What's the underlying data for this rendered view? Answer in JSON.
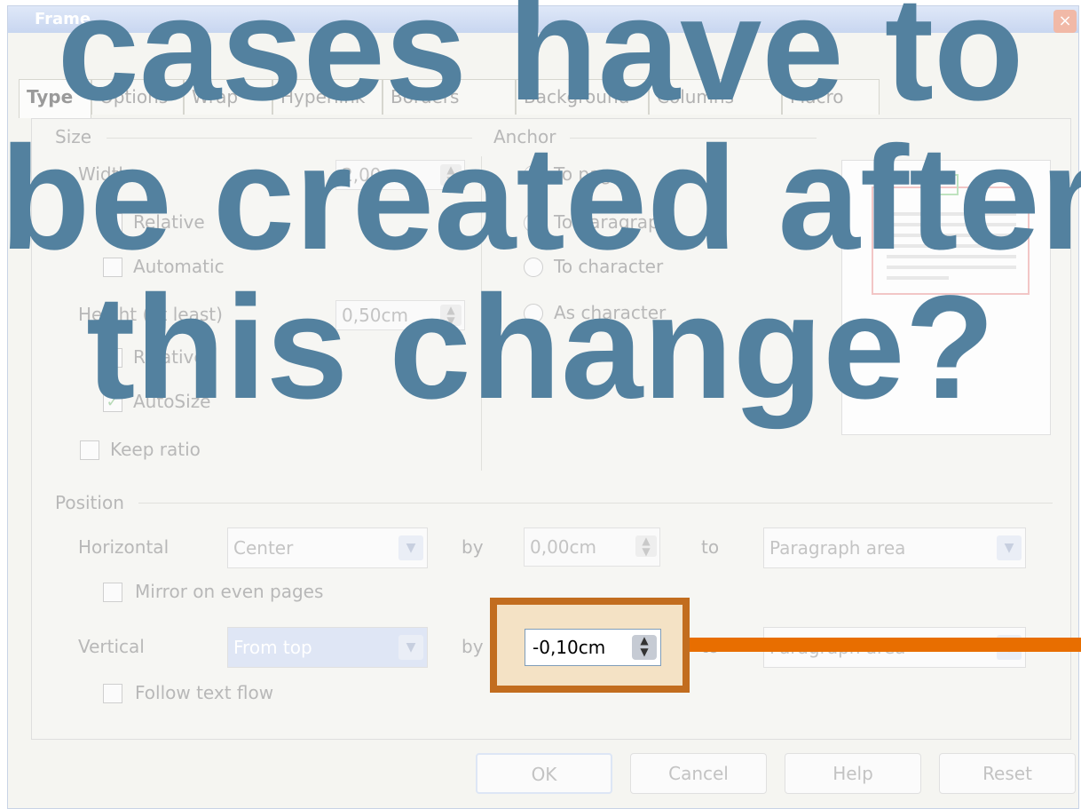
{
  "dialog": {
    "title": "Frame",
    "close_glyph": "×",
    "tabs": [
      "Type",
      "Options",
      "Wrap",
      "Hyperlink",
      "Borders",
      "Background",
      "Columns",
      "Macro"
    ],
    "size": {
      "group_label": "Size",
      "width_label": "Width",
      "width_value": "2,00cm",
      "relative_label": "Relative",
      "automatic_label": "Automatic",
      "height_label": "Height (at least)",
      "height_value": "0,50cm",
      "relative2_label": "Relative",
      "autosize_label": "AutoSize",
      "keep_ratio_label": "Keep ratio"
    },
    "anchor": {
      "group_label": "Anchor",
      "to_page": "To page",
      "to_paragraph": "To paragraph",
      "to_character": "To character",
      "as_character": "As character"
    },
    "position": {
      "group_label": "Position",
      "horizontal_label": "Horizontal",
      "horizontal_value": "Center",
      "by_label": "by",
      "horizontal_by_value": "0,00cm",
      "to_label": "to",
      "horizontal_to_value": "Paragraph area",
      "mirror_label": "Mirror on even pages",
      "vertical_label": "Vertical",
      "vertical_value": "From top",
      "vertical_by_label": "by",
      "vertical_to_label": "to",
      "vertical_to_value": "Paragraph area",
      "follow_label": "Follow text flow"
    },
    "buttons": {
      "ok": "OK",
      "cancel": "Cancel",
      "help": "Help",
      "reset": "Reset"
    }
  },
  "highlight": {
    "vertical_by_value": "-0,10cm"
  },
  "overlay": {
    "line1": "cases have to",
    "line2": "be created after",
    "line3": "this change?",
    "color": "#53819f"
  },
  "accents": {
    "highlight_border": "#c26d1f",
    "connector": "#e86e00"
  }
}
